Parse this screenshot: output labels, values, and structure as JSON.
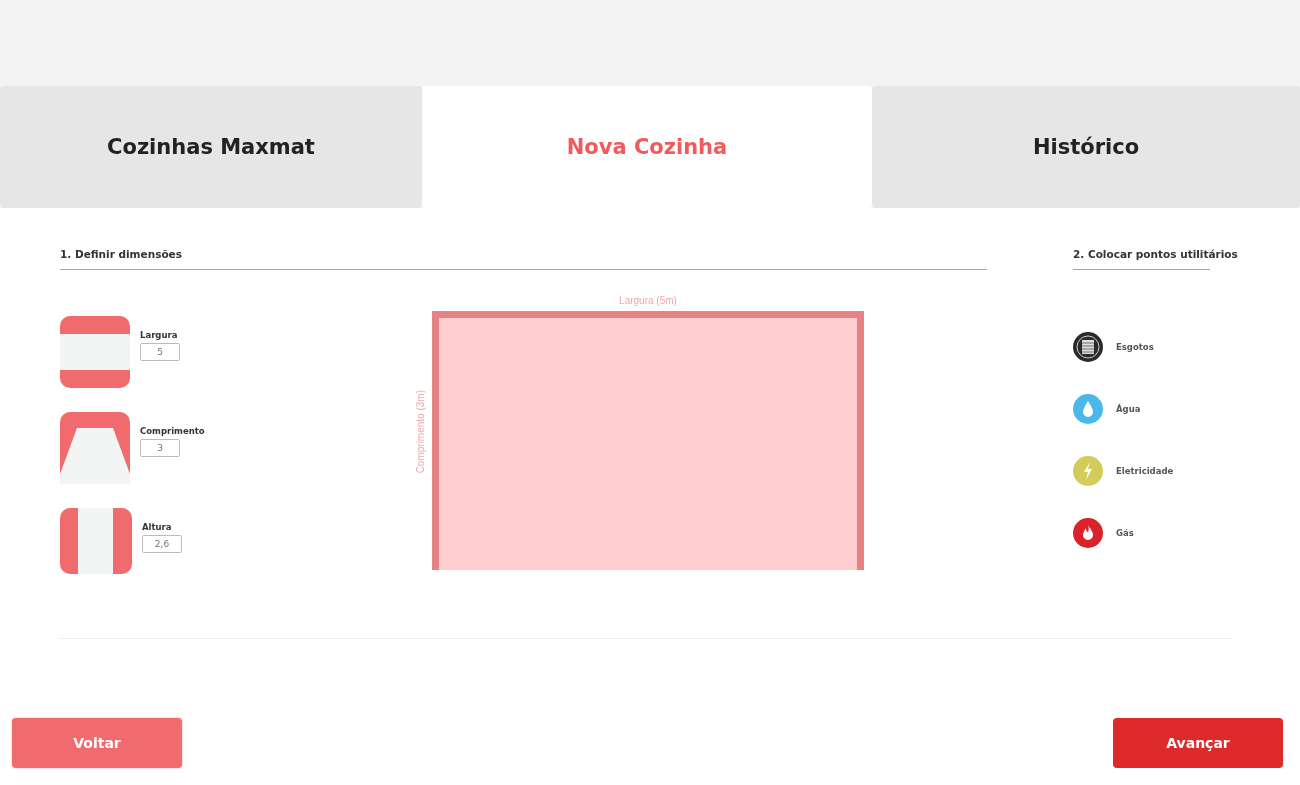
{
  "tabs": [
    {
      "label": "Cozinhas Maxmat",
      "selected": false
    },
    {
      "label": "Nova Cozinha",
      "selected": true
    },
    {
      "label": "Histórico",
      "selected": false
    }
  ],
  "dimensions": {
    "title": "1. Definir dimensões",
    "fields": [
      {
        "kind": "width",
        "label": "Largura",
        "value": "5"
      },
      {
        "kind": "length",
        "label": "Comprimento",
        "value": "3"
      },
      {
        "kind": "height",
        "label": "Altura",
        "value": "2,6"
      }
    ]
  },
  "plan": {
    "width_label": "Largura (5m)",
    "length_label": "Comprimento (3m)"
  },
  "utilities": {
    "title": "2. Colocar pontos utilitários",
    "items": [
      {
        "kind": "sewer",
        "label": "Esgotos",
        "color": "#2b2b2b"
      },
      {
        "kind": "water",
        "label": "Água",
        "color": "#4ab8ea"
      },
      {
        "kind": "electricity",
        "label": "Eletricidade",
        "color": "#d2cc5a"
      },
      {
        "kind": "gas",
        "label": "Gás",
        "color": "#d9222a"
      }
    ]
  },
  "buttons": {
    "back": "Voltar",
    "next": "Avançar"
  }
}
